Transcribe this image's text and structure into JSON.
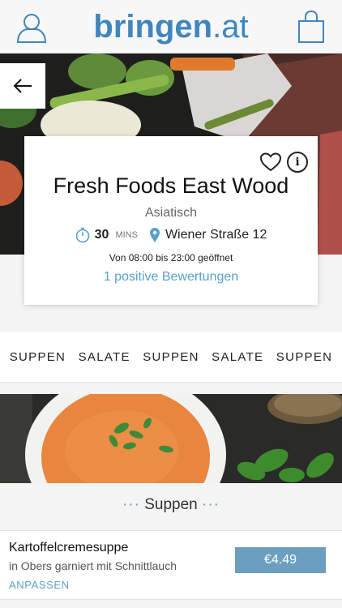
{
  "header": {
    "logo_main": "bringen",
    "logo_tld": ".at",
    "user_icon": "user-icon",
    "cart_icon": "shopping-bag-icon"
  },
  "hero": {
    "back_icon": "arrow-left-icon"
  },
  "restaurant": {
    "name": "Fresh Foods East Wood",
    "cuisine": "Asiatisch",
    "delivery_time": "30",
    "delivery_unit": "MINS",
    "address": "Wiener Straße 12",
    "hours": "Von 08:00 bis 23:00 geöffnet",
    "reviews": "1 positive Bewertungen",
    "favorite_icon": "heart-icon",
    "info_icon": "info-icon",
    "info_glyph": "i"
  },
  "categories": [
    "SUPPEN",
    "SALATE",
    "SUPPEN",
    "SALATE",
    "SUPPEN"
  ],
  "section": {
    "dots_left": "···",
    "title": "Suppen",
    "dots_right": "···"
  },
  "product": {
    "name": "Kartoffelcremesuppe",
    "description": "in Obers garniert mit Schnittlauch",
    "customize_label": "ANPASSEN",
    "price": "€4.49"
  },
  "colors": {
    "brand": "#3f86bd",
    "accent": "#5aa0cc",
    "price_button": "#6b9fc0"
  }
}
